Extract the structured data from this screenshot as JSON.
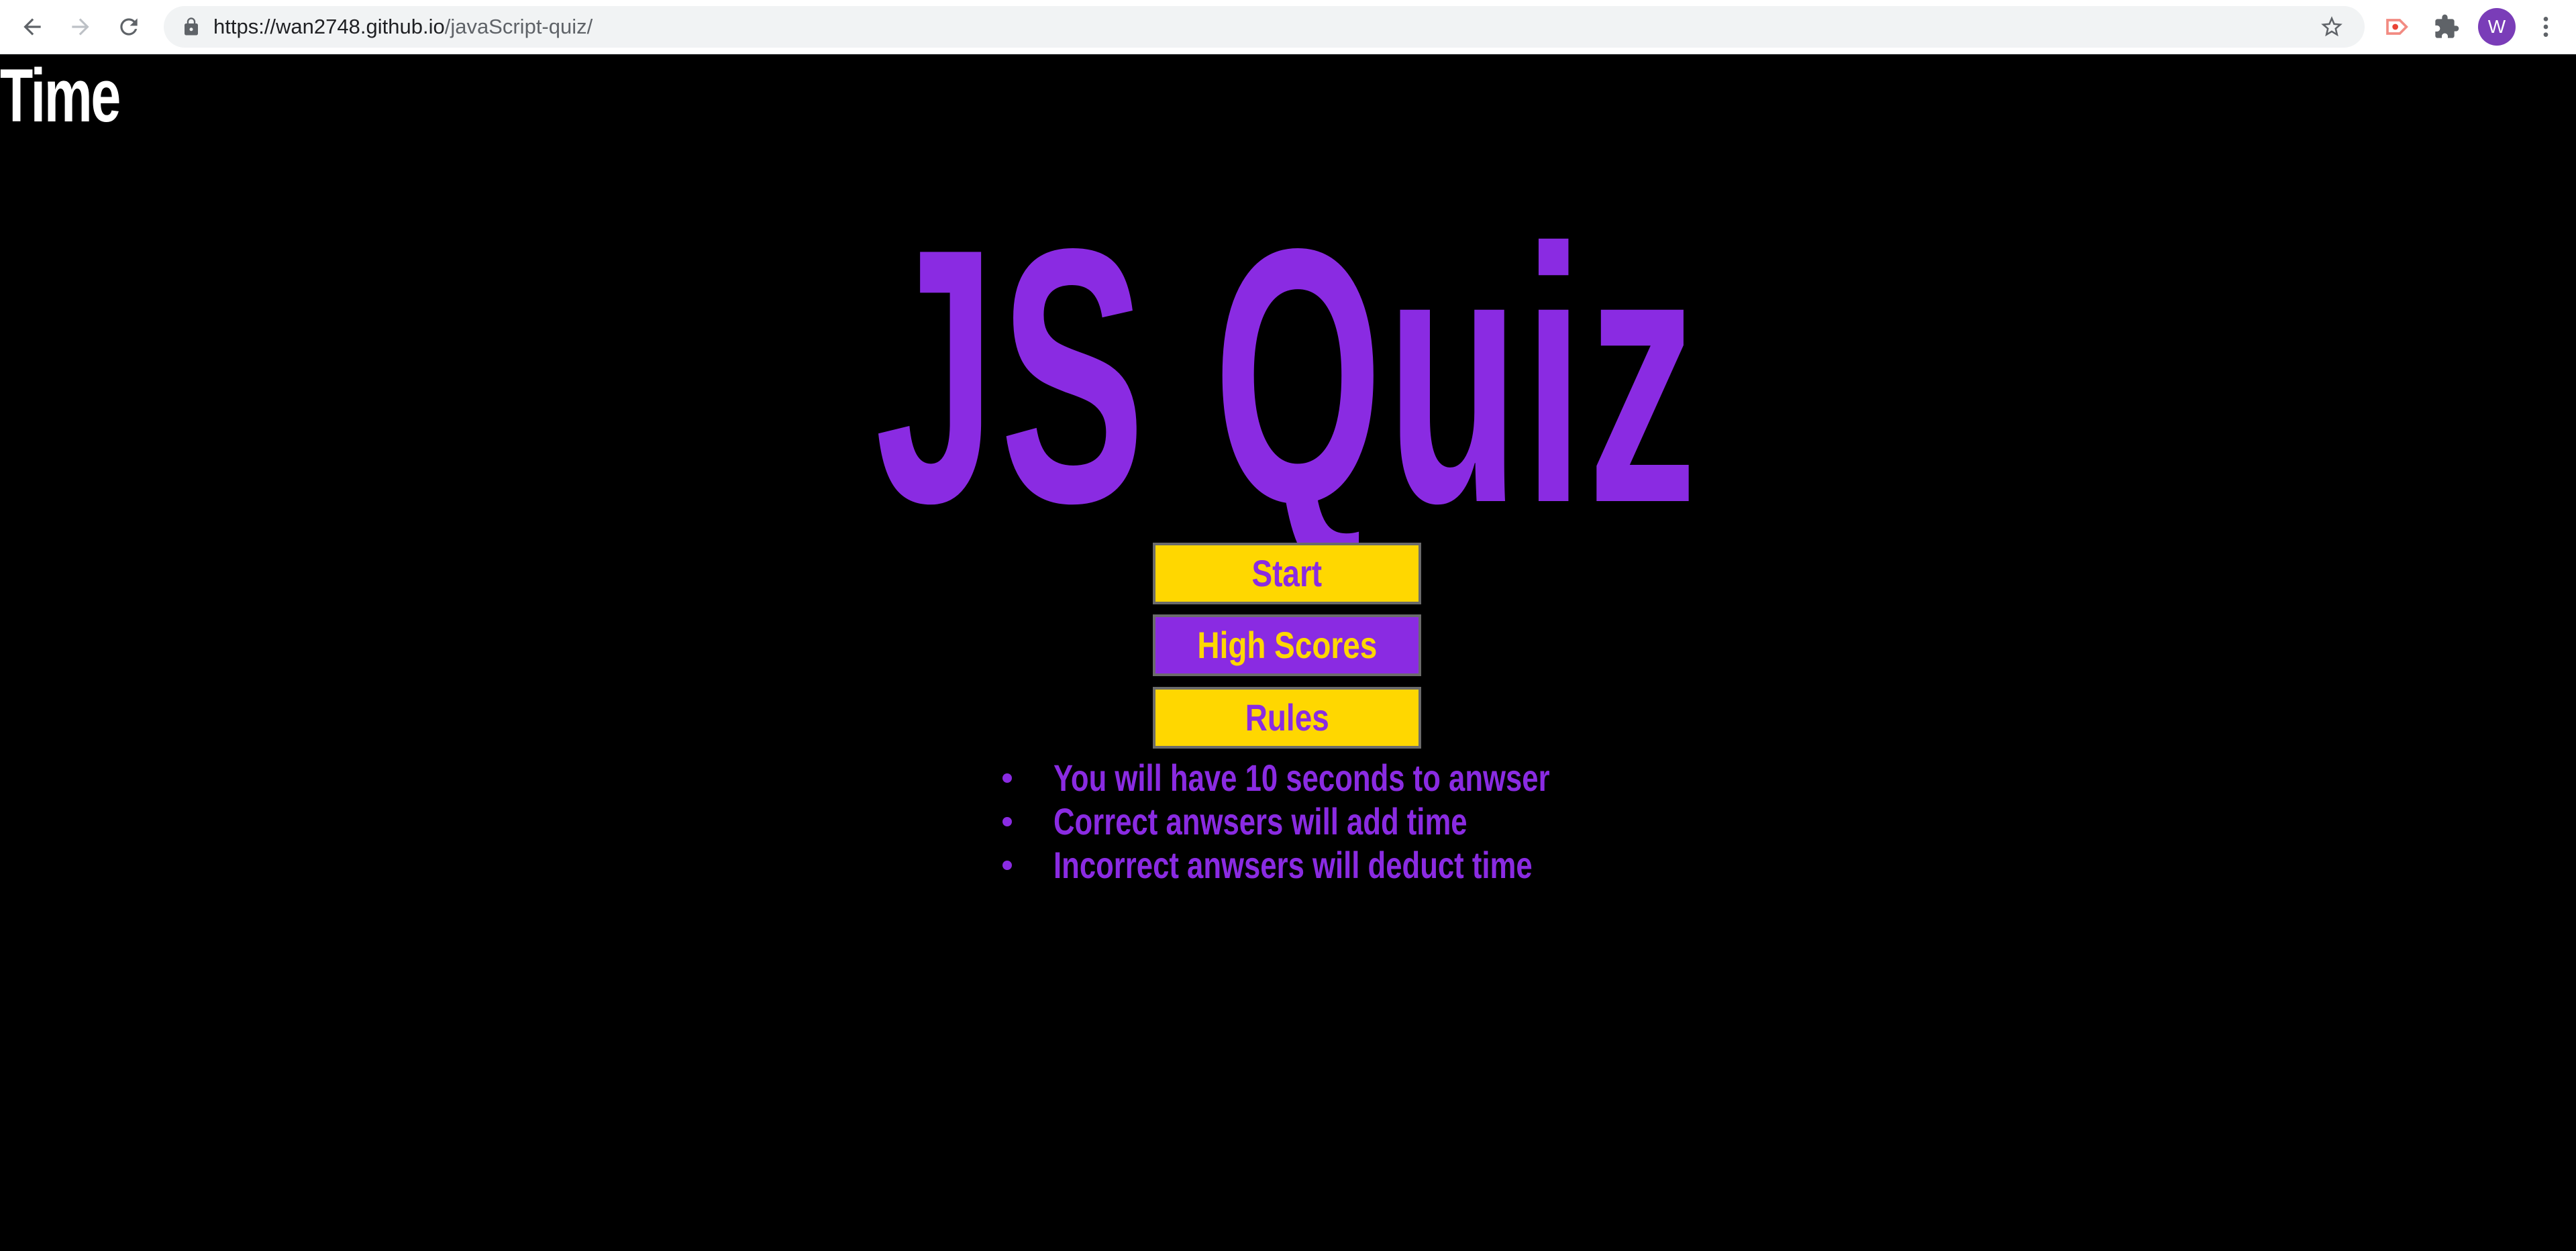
{
  "browser": {
    "url_domain": "https://wan2748.github.io",
    "url_path": "/javaScript-quiz/",
    "avatar_letter": "W",
    "icons": [
      "back-arrow-icon",
      "forward-arrow-icon",
      "reload-icon",
      "lock-icon",
      "star-icon",
      "record-extension-icon",
      "puzzle-icon",
      "menu-dots-icon"
    ]
  },
  "page": {
    "timer_label": "Time",
    "title": "JS Quiz",
    "buttons": {
      "start": "Start",
      "high_scores": "High Scores",
      "rules": "Rules"
    },
    "rules": [
      "You will have 10 seconds to anwser",
      "Correct anwsers will add time",
      "Incorrect anwsers will deduct time"
    ]
  },
  "colors": {
    "background": "#000000",
    "accent_purple": "#8a2be2",
    "accent_yellow": "#ffd700",
    "timer_text": "#ffffff"
  }
}
